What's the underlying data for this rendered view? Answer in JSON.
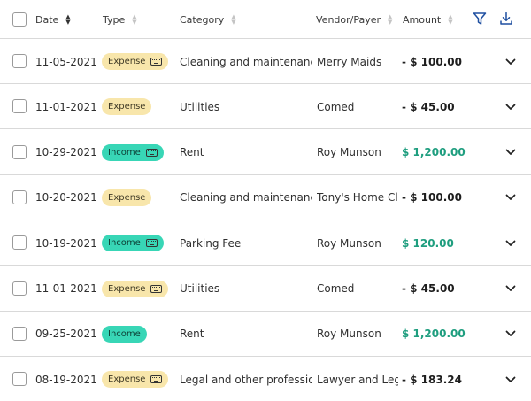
{
  "header": {
    "date": "Date",
    "type": "Type",
    "category": "Category",
    "vendor": "Vendor/Payer",
    "amount": "Amount"
  },
  "colors": {
    "expense_badge": "#f8e6ab",
    "income_badge": "#38d6b6",
    "positive_amount": "#1f9e7f",
    "accent_icon": "#1e4fa0"
  },
  "icons": {
    "filter": "filter-icon",
    "download": "download-icon",
    "row_expand": "chevron-down-icon",
    "badge": "keyboard-icon"
  },
  "rows": [
    {
      "date": "11-05-2021",
      "type": "Expense",
      "kind": "expense",
      "icon": true,
      "category": "Cleaning and maintenance",
      "vendor": "Merry Maids",
      "amount": "- $ 100.00",
      "sign": "neg"
    },
    {
      "date": "11-01-2021",
      "type": "Expense",
      "kind": "expense",
      "icon": false,
      "category": "Utilities",
      "vendor": "Comed",
      "amount": "- $ 45.00",
      "sign": "neg"
    },
    {
      "date": "10-29-2021",
      "type": "Income",
      "kind": "income",
      "icon": true,
      "category": "Rent",
      "vendor": "Roy Munson",
      "amount": "$ 1,200.00",
      "sign": "pos"
    },
    {
      "date": "10-20-2021",
      "type": "Expense",
      "kind": "expense",
      "icon": false,
      "category": "Cleaning and maintenance",
      "vendor": "Tony's Home Cl...",
      "amount": "- $ 100.00",
      "sign": "neg"
    },
    {
      "date": "10-19-2021",
      "type": "Income",
      "kind": "income",
      "icon": true,
      "category": "Parking Fee",
      "vendor": "Roy Munson",
      "amount": "$ 120.00",
      "sign": "pos"
    },
    {
      "date": "11-01-2021",
      "type": "Expense",
      "kind": "expense",
      "icon": true,
      "category": "Utilities",
      "vendor": "Comed",
      "amount": "- $ 45.00",
      "sign": "neg"
    },
    {
      "date": "09-25-2021",
      "type": "Income",
      "kind": "income",
      "icon": false,
      "category": "Rent",
      "vendor": "Roy Munson",
      "amount": "$ 1,200.00",
      "sign": "pos"
    },
    {
      "date": "08-19-2021",
      "type": "Expense",
      "kind": "expense",
      "icon": true,
      "category": "Legal and other profession...",
      "vendor": "Lawyer and Leg...",
      "amount": "- $ 183.24",
      "sign": "neg"
    }
  ]
}
